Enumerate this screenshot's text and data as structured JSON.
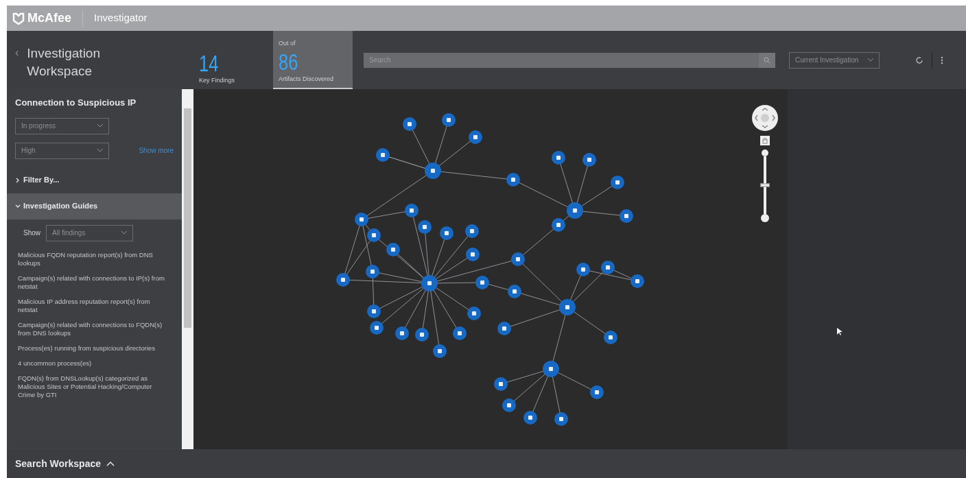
{
  "app_bar": {
    "brand": "McAfee",
    "product": "Investigator"
  },
  "workspace": {
    "back": "‹",
    "title": "Investigation Workspace"
  },
  "stats": [
    {
      "number": "14",
      "label": "Key Findings",
      "selected": false
    },
    {
      "caption_top": "Out of",
      "number": "86",
      "label": "Artifacts Discovered",
      "selected": true
    }
  ],
  "search": {
    "placeholder": "Search"
  },
  "scope_select": {
    "value": "Current Investigation"
  },
  "sidebar": {
    "title": "Connection to Suspicious IP",
    "status_select": "In progress",
    "priority_select": "High",
    "show_more": "Show more",
    "sections": [
      {
        "label": "Filter By...",
        "expanded": false
      },
      {
        "label": "Investigation Guides",
        "expanded": true
      }
    ],
    "show_label": "Show",
    "show_select": "All findings",
    "guides": [
      "Malicious FQDN reputation report(s) from DNS lookups",
      "Campaign(s) related with connections to IP(s) from netstat",
      "Malicious IP address reputation report(s) from netstat",
      "Campaign(s) related with connections to FQDN(s) from DNS lookups",
      "Process(es) running from suspicious directories",
      "4 uncommon process(es)",
      "FQDN(s) from DNSLookup(s) categorized as Malicious Sites or Potential Hacking/Computer Crime by GTI"
    ]
  },
  "zoom": {
    "level": 0.5
  },
  "bottom_bar": {
    "label": "Search Workspace"
  }
}
